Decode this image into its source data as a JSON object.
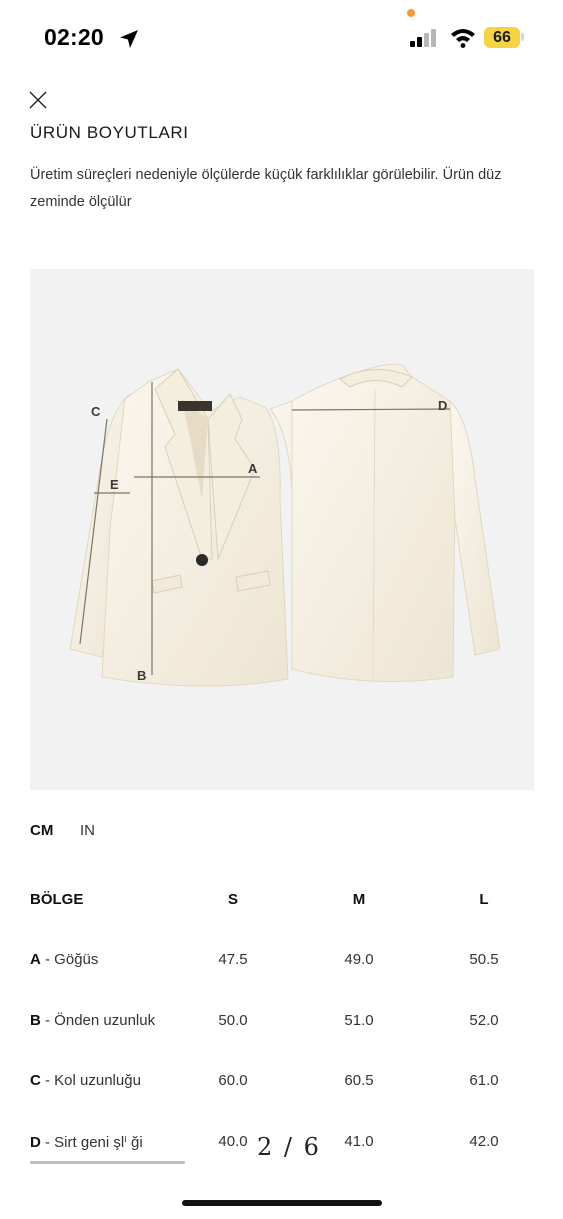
{
  "status_bar": {
    "time": "02:20",
    "battery": "66",
    "icons": [
      "location-arrow-icon",
      "signal-icon",
      "wifi-icon",
      "battery-icon"
    ]
  },
  "header": {
    "close_icon": "close-icon",
    "title": "ÜRÜN BOYUTLARI",
    "description": "Üretim süreçleri nedeniyle ölçülerde küçük farklılıklar görülebilir. Ürün düz zeminde ölçülür"
  },
  "diagram": {
    "labels": [
      "A",
      "B",
      "C",
      "D",
      "E"
    ]
  },
  "units": {
    "cm": "CM",
    "in": "IN",
    "selected": "CM"
  },
  "table": {
    "headers": {
      "region": "BÖLGE",
      "s": "S",
      "m": "M",
      "l": "L"
    },
    "rows": [
      {
        "code": "A",
        "name": "- Göğüs",
        "s": "47.5",
        "m": "49.0",
        "l": "50.5"
      },
      {
        "code": "B",
        "name": "- Önden uzunluk",
        "s": "50.0",
        "m": "51.0",
        "l": "52.0"
      },
      {
        "code": "C",
        "name": "- Kol uzunluğu",
        "s": "60.0",
        "m": "60.5",
        "l": "61.0"
      },
      {
        "code": "D",
        "name": "- Sirt geni şlⁱ ği",
        "s": "40.0",
        "m": "41.0",
        "l": "42.0"
      }
    ]
  },
  "page_indicator": "2 / 6"
}
